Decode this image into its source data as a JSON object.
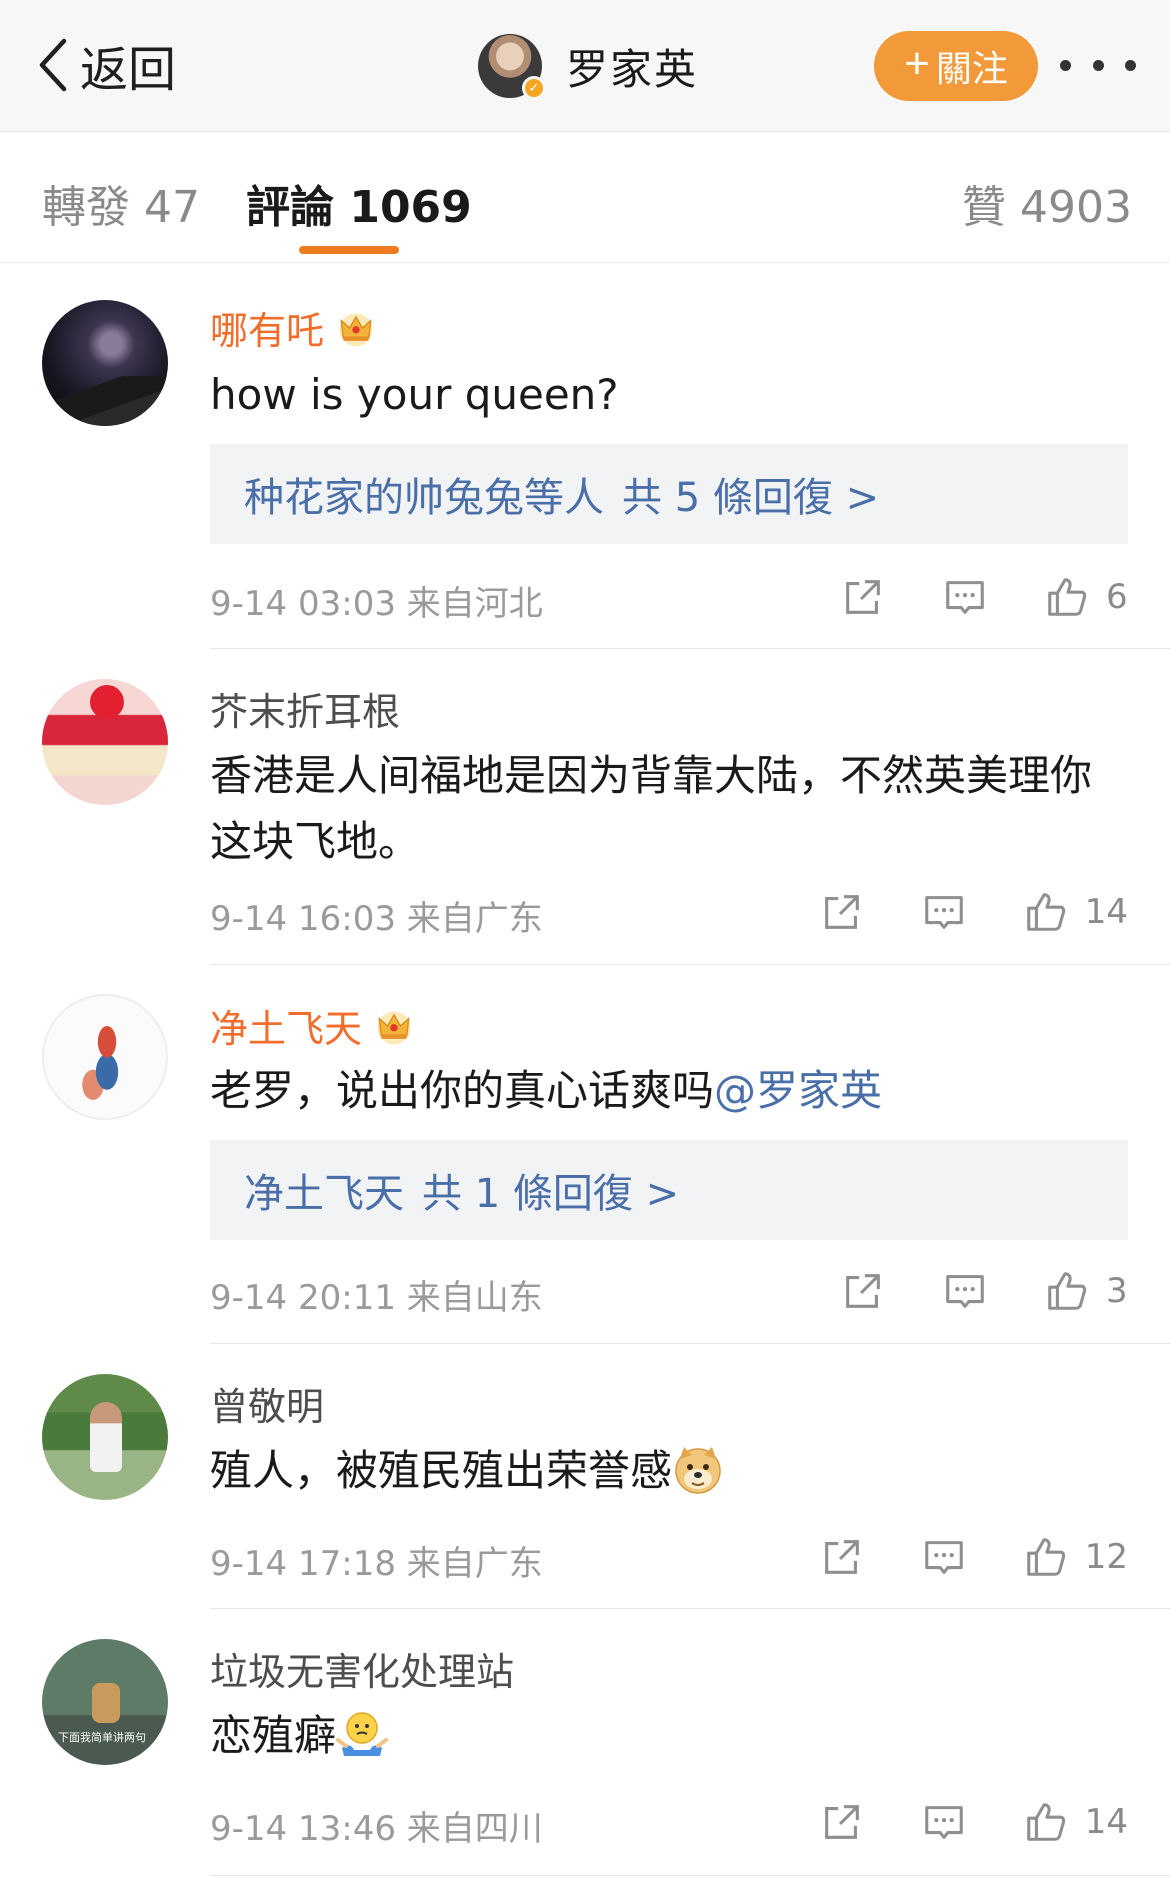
{
  "nav": {
    "back_label": "返回",
    "title": "罗家英",
    "follow_label": "關注"
  },
  "tabs": {
    "repost_label": "轉發",
    "repost_count": "47",
    "comment_label": "評論",
    "comment_count": "1069",
    "like_label": "贊",
    "like_count": "4903"
  },
  "comments": [
    {
      "user": "哪有吒",
      "text": "how is your queen?",
      "reply_names": "种花家的帅兔兔等人",
      "reply_count_text": "共 5 條回復 >",
      "time": "9-14 03:03",
      "location": "来自河北",
      "likes": "6"
    },
    {
      "user": "芥末折耳根",
      "text": "香港是人间福地是因为背靠大陆，不然英美理你这块飞地。",
      "time": "9-14 16:03",
      "location": "来自广东",
      "likes": "14"
    },
    {
      "user": "净土飞天",
      "text": "老罗，说出你的真心话爽吗",
      "mention": "@罗家英",
      "reply_names": "净土飞天",
      "reply_count_text": "共 1 條回復 >",
      "time": "9-14 20:11",
      "location": "来自山东",
      "likes": "3"
    },
    {
      "user": "曾敬明",
      "text": "殖人，被殖民殖出荣誉感",
      "time": "9-14 17:18",
      "location": "来自广东",
      "likes": "12"
    },
    {
      "user": "垃圾无害化处理站",
      "text": "恋殖癖",
      "avatar_caption": "下面我简单讲两句",
      "time": "9-14 13:46",
      "location": "来自四川",
      "likes": "14"
    }
  ],
  "colors": {
    "accent_orange": "#f29a39",
    "tab_underline": "#f07a1e",
    "vip_name": "#f26c2b",
    "link_blue": "#4a6fa8"
  }
}
